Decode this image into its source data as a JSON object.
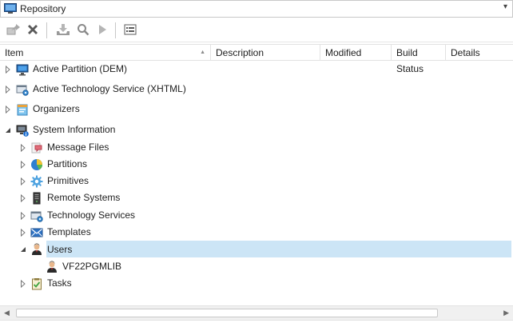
{
  "window": {
    "title": "Repository",
    "dropdown_glyph": "▾"
  },
  "toolbar": {
    "buttons": [
      {
        "name": "open-icon",
        "tooltip_icon": "export-arrow-icon"
      },
      {
        "name": "delete-icon",
        "tooltip_icon": "x-icon"
      },
      {
        "name": "checkin-icon",
        "tooltip_icon": "download-tray-icon"
      },
      {
        "name": "search-icon",
        "tooltip_icon": "magnifier-icon"
      },
      {
        "name": "run-icon",
        "tooltip_icon": "play-icon"
      },
      {
        "name": "properties-icon",
        "tooltip_icon": "list-box-icon"
      }
    ]
  },
  "columns": [
    {
      "label": "Item"
    },
    {
      "label": "Description"
    },
    {
      "label": "Modified"
    },
    {
      "label": "Build Status"
    },
    {
      "label": "Details"
    }
  ],
  "tree": {
    "items": [
      {
        "label": "Active Partition (DEM)",
        "icon": "monitor-icon",
        "expanded": false
      },
      {
        "label": "Active Technology Service (XHTML)",
        "icon": "technology-service-icon",
        "expanded": false
      },
      {
        "label": "Organizers",
        "icon": "organizer-icon",
        "expanded": false
      },
      {
        "label": "System Information",
        "icon": "system-info-icon",
        "expanded": true
      },
      {
        "label": "Message Files",
        "icon": "message-files-icon",
        "expanded": false
      },
      {
        "label": "Partitions",
        "icon": "partition-pie-icon",
        "expanded": false
      },
      {
        "label": "Primitives",
        "icon": "gear-icon",
        "expanded": false
      },
      {
        "label": "Remote Systems",
        "icon": "server-icon",
        "expanded": false
      },
      {
        "label": "Technology Services",
        "icon": "technology-service-icon",
        "expanded": false
      },
      {
        "label": "Templates",
        "icon": "template-envelope-icon",
        "expanded": false
      },
      {
        "label": "Users",
        "icon": "user-icon",
        "expanded": true,
        "selected": true
      },
      {
        "label": "VF22PGMLIB",
        "icon": "user-icon"
      },
      {
        "label": "Tasks",
        "icon": "clipboard-check-icon",
        "expanded": false
      }
    ]
  },
  "colors": {
    "selection": "#cce5f6",
    "border": "#e2e2e2"
  }
}
